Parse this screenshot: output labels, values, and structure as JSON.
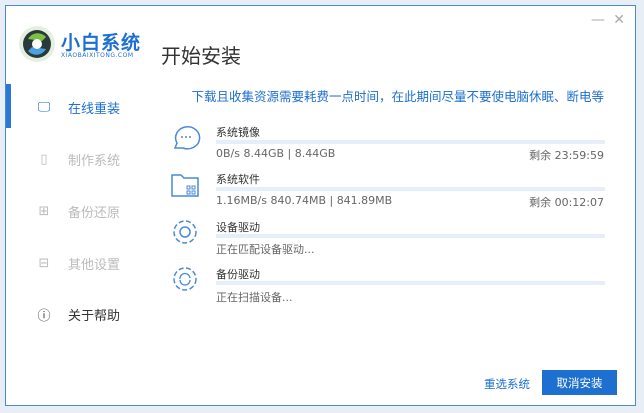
{
  "app": {
    "name": "小白系统",
    "subtitle": "XIAOBAIXITONG.COM"
  },
  "page_title": "开始安装",
  "window_controls": {
    "minimize": "—",
    "close": "✕"
  },
  "sidebar": {
    "items": [
      {
        "label": "在线重装",
        "icon": "monitor-icon",
        "state": "active"
      },
      {
        "label": "制作系统",
        "icon": "usb-icon",
        "state": "disabled"
      },
      {
        "label": "备份还原",
        "icon": "backup-icon",
        "state": "disabled"
      },
      {
        "label": "其他设置",
        "icon": "toolbox-icon",
        "state": "disabled"
      },
      {
        "label": "关于帮助",
        "icon": "info-icon",
        "state": "normal"
      }
    ]
  },
  "notice": "下载且收集资源需要耗费一点时间，在此期间尽量不要使电脑休眠、断电等",
  "tasks": [
    {
      "label": "系统镜像",
      "icon": "chat-bubble-icon",
      "info": "0B/s 8.44GB | 8.44GB",
      "remaining": "剩余 23:59:59",
      "progress": 0
    },
    {
      "label": "系统软件",
      "icon": "folder-apps-icon",
      "info": "1.16MB/s 840.74MB | 841.89MB",
      "remaining": "剩余 00:12:07",
      "progress": 0
    },
    {
      "label": "设备驱动",
      "icon": "gear-icon",
      "info": "正在匹配设备驱动...",
      "progress": 0
    },
    {
      "label": "备份驱动",
      "icon": "gear-sync-icon",
      "info": "正在扫描设备...",
      "progress": 0
    }
  ],
  "buttons": {
    "reselect": "重选系统",
    "cancel": "取消安装"
  },
  "colors": {
    "accent": "#1d6fd0"
  }
}
